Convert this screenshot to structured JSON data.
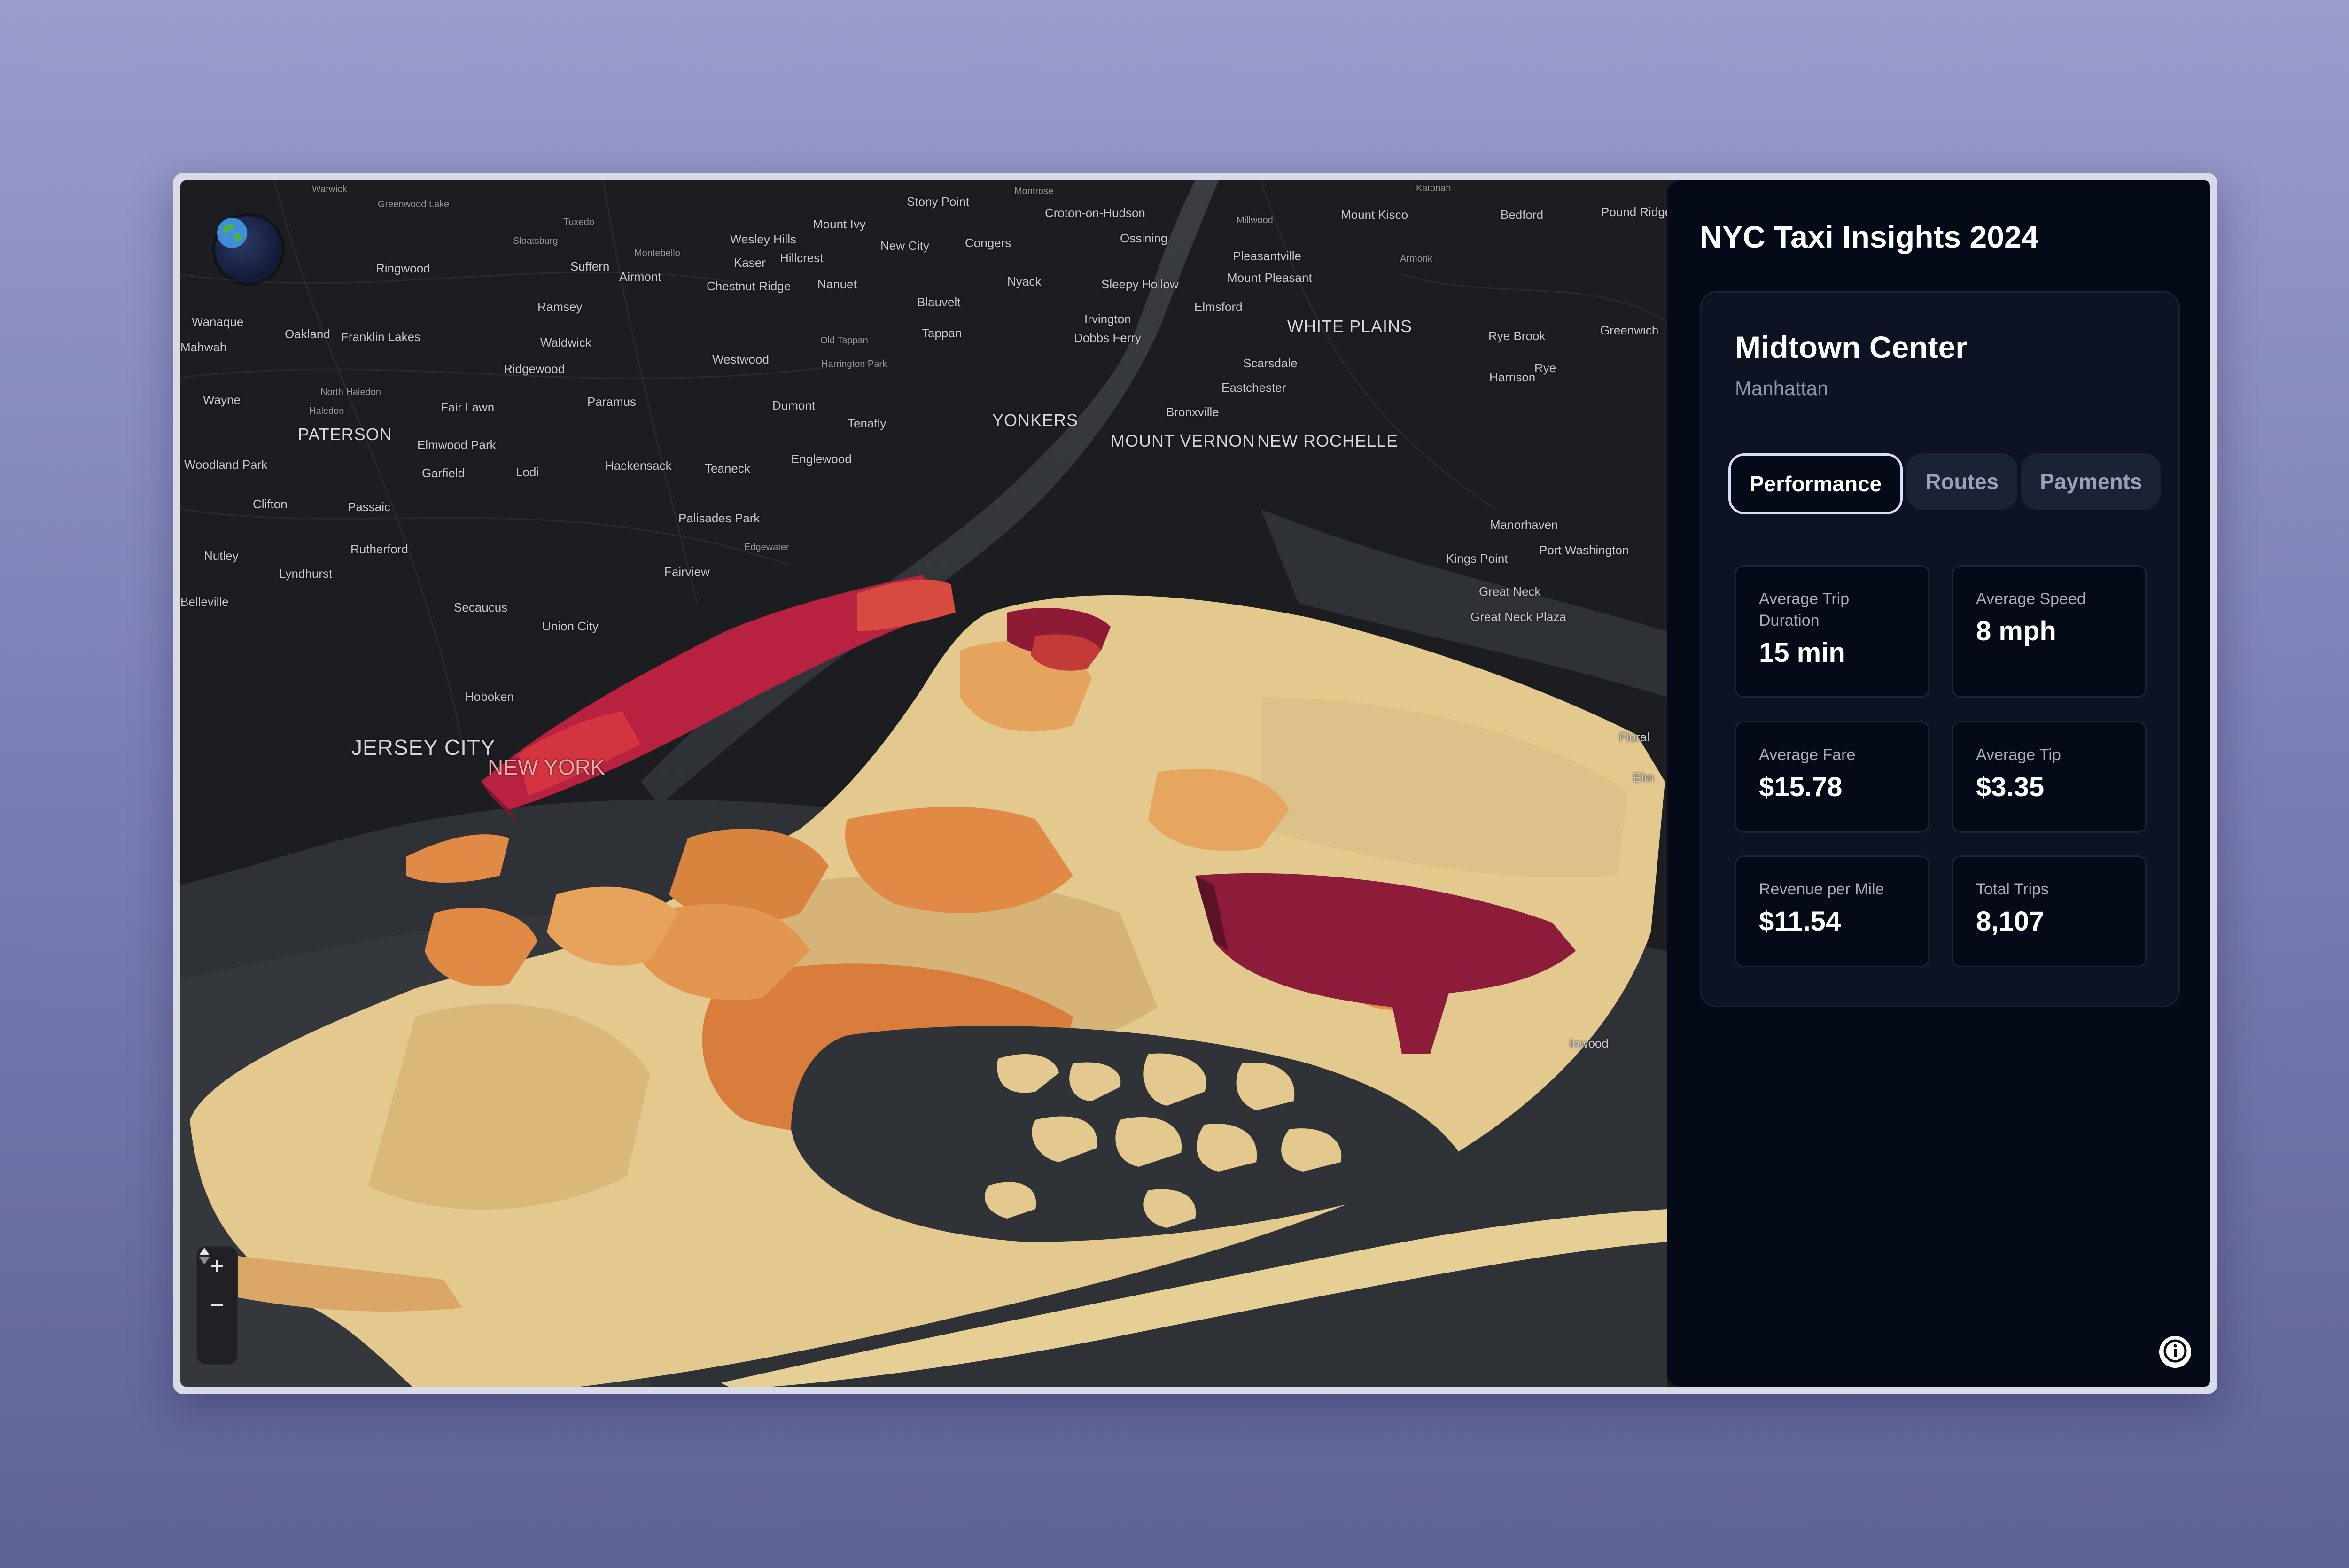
{
  "app": {
    "title": "NYC Taxi Insights 2024"
  },
  "location": {
    "name": "Midtown Center",
    "borough": "Manhattan"
  },
  "tabs": [
    {
      "label": "Performance",
      "active": true
    },
    {
      "label": "Routes",
      "active": false
    },
    {
      "label": "Payments",
      "active": false
    }
  ],
  "stats": [
    {
      "label": "Average Trip Duration",
      "value": "15 min"
    },
    {
      "label": "Average Speed",
      "value": "8 mph"
    },
    {
      "label": "Average Fare",
      "value": "$15.78"
    },
    {
      "label": "Average Tip",
      "value": "$3.35"
    },
    {
      "label": "Revenue per Mile",
      "value": "$11.54"
    },
    {
      "label": "Total Trips",
      "value": "8,107"
    }
  ],
  "map": {
    "controls": {
      "globe_icon": "globe-icon",
      "zoom_in": "+",
      "zoom_out": "−",
      "compass_icon": "compass-icon"
    },
    "labels": [
      "Warwick",
      "Greenwood Lake",
      "Tuxedo",
      "Stony Point",
      "Montrose",
      "Croton-on-Hudson",
      "Millwood",
      "Mount Kisco",
      "Bedford",
      "Pound Ridge",
      "Katonah",
      "Sloatsburg",
      "Montebello",
      "Wesley Hills",
      "Mount Ivy",
      "New City",
      "Congers",
      "Ossining",
      "Pleasantville",
      "Armonk",
      "Ringwood",
      "Suffern",
      "Airmont",
      "Kaser",
      "Hillcrest",
      "Chestnut Ridge",
      "Nanuet",
      "Nyack",
      "Sleepy Hollow",
      "Mount Pleasant",
      "Wanaque",
      "Ramsey",
      "Blauvelt",
      "Irvington",
      "Elmsford",
      "WHITE PLAINS",
      "Oakland",
      "Franklin Lakes",
      "Mahwah",
      "Dobbs Ferry",
      "Tappan",
      "Old Tappan",
      "Rye Brook",
      "Greenwich",
      "Waldwick",
      "Westwood",
      "Harrington Park",
      "Scarsdale",
      "Ridgewood",
      "Harrison",
      "Rye",
      "Eastchester",
      "Wayne",
      "North Haledon",
      "Haledon",
      "Fair Lawn",
      "Paramus",
      "Dumont",
      "Bronxville",
      "YONKERS",
      "Tenafly",
      "MOUNT VERNON",
      "NEW ROCHELLE",
      "PATERSON",
      "Elmwood Park",
      "Woodland Park",
      "Garfield",
      "Lodi",
      "Hackensack",
      "Teaneck",
      "Englewood",
      "Clifton",
      "Passaic",
      "Palisades Park",
      "Manorhaven",
      "Edgewater",
      "Port Washington",
      "Nutley",
      "Rutherford",
      "Kings Point",
      "Lyndhurst",
      "Fairview",
      "Great Neck",
      "Belleville",
      "Secaucus",
      "Great Neck Plaza",
      "Union City",
      "Hoboken",
      "JERSEY CITY",
      "NEW YORK",
      "Floral",
      "Elm",
      "Inwood"
    ]
  }
}
